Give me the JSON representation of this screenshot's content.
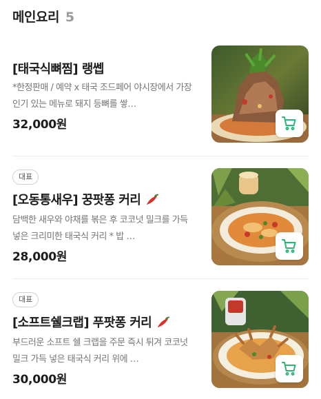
{
  "section": {
    "title": "메인요리",
    "count": "5"
  },
  "items": [
    {
      "badge": "",
      "name": "[태국식뼈찜] 랭쎕",
      "spicy": false,
      "description": "*한정판매 / 예약 x 태국 조드페어 야시장에서 가장 인기 있는 메뉴로 돼지 등뼈를 쌓…",
      "price": "32,000원",
      "image": "pork-bone-stew-photo"
    },
    {
      "badge": "대표",
      "name": "[오동통새우] 꿍팟퐁 커리",
      "spicy": true,
      "description": "담백한 새우와 야채를 볶은 후 코코넛 밀크를 가득 넣은 크리미한 태국식 커리 * 밥 …",
      "price": "28,000원",
      "image": "shrimp-curry-photo"
    },
    {
      "badge": "대표",
      "name": "[소프트쉘크랩] 푸팟퐁 커리",
      "spicy": true,
      "description": "부드러운 소프트 쉘 크랩을 주문 즉시 튀겨 코코넛 밀크 가득 넣은 태국식 커리 위에 …",
      "price": "30,000원",
      "image": "soft-shell-crab-curry-photo"
    }
  ],
  "icons": {
    "cart": "cart-icon",
    "spicy": "chili-pepper-icon"
  },
  "colors": {
    "accent": "#2bb673",
    "chili": "#d8322a",
    "price": "#1c1c1c",
    "description": "#757575",
    "count": "#9a9a9a"
  }
}
